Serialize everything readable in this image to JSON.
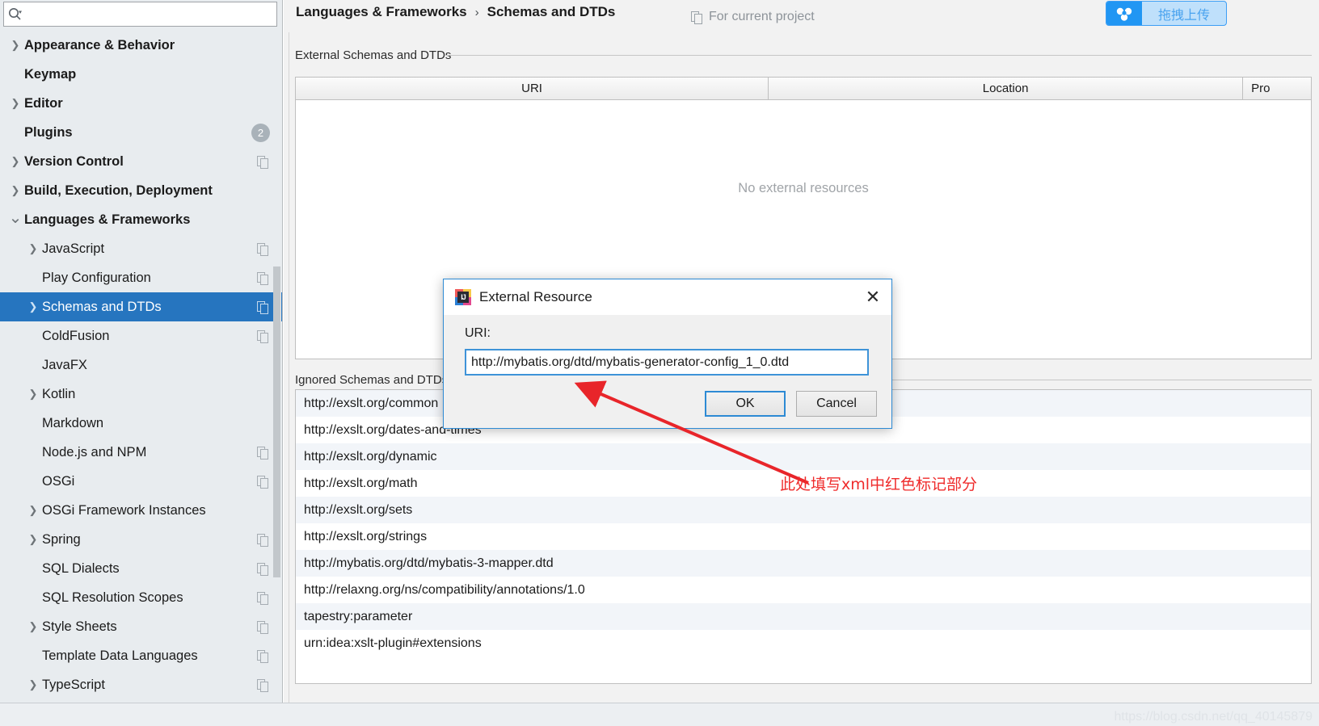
{
  "search": {
    "value": "",
    "placeholder": "",
    "icon": "search-icon"
  },
  "sidebar": {
    "items": [
      {
        "label": "Appearance & Behavior",
        "level": 0,
        "arrow": "right",
        "badge": null,
        "copy": false,
        "selected": false
      },
      {
        "label": "Keymap",
        "level": 0,
        "arrow": "none",
        "badge": null,
        "copy": false,
        "selected": false
      },
      {
        "label": "Editor",
        "level": 0,
        "arrow": "right",
        "badge": null,
        "copy": false,
        "selected": false
      },
      {
        "label": "Plugins",
        "level": 0,
        "arrow": "none",
        "badge": "2",
        "copy": false,
        "selected": false
      },
      {
        "label": "Version Control",
        "level": 0,
        "arrow": "right",
        "badge": null,
        "copy": true,
        "selected": false
      },
      {
        "label": "Build, Execution, Deployment",
        "level": 0,
        "arrow": "right",
        "badge": null,
        "copy": false,
        "selected": false
      },
      {
        "label": "Languages & Frameworks",
        "level": 0,
        "arrow": "down",
        "badge": null,
        "copy": false,
        "selected": false
      },
      {
        "label": "JavaScript",
        "level": 1,
        "arrow": "right",
        "badge": null,
        "copy": true,
        "selected": false
      },
      {
        "label": "Play Configuration",
        "level": 1,
        "arrow": "none",
        "badge": null,
        "copy": true,
        "selected": false
      },
      {
        "label": "Schemas and DTDs",
        "level": 1,
        "arrow": "right",
        "badge": null,
        "copy": true,
        "selected": true
      },
      {
        "label": "ColdFusion",
        "level": 1,
        "arrow": "none",
        "badge": null,
        "copy": true,
        "selected": false
      },
      {
        "label": "JavaFX",
        "level": 1,
        "arrow": "none",
        "badge": null,
        "copy": false,
        "selected": false
      },
      {
        "label": "Kotlin",
        "level": 1,
        "arrow": "right",
        "badge": null,
        "copy": false,
        "selected": false
      },
      {
        "label": "Markdown",
        "level": 1,
        "arrow": "none",
        "badge": null,
        "copy": false,
        "selected": false
      },
      {
        "label": "Node.js and NPM",
        "level": 1,
        "arrow": "none",
        "badge": null,
        "copy": true,
        "selected": false
      },
      {
        "label": "OSGi",
        "level": 1,
        "arrow": "none",
        "badge": null,
        "copy": true,
        "selected": false
      },
      {
        "label": "OSGi Framework Instances",
        "level": 1,
        "arrow": "right",
        "badge": null,
        "copy": false,
        "selected": false
      },
      {
        "label": "Spring",
        "level": 1,
        "arrow": "right",
        "badge": null,
        "copy": true,
        "selected": false
      },
      {
        "label": "SQL Dialects",
        "level": 1,
        "arrow": "none",
        "badge": null,
        "copy": true,
        "selected": false
      },
      {
        "label": "SQL Resolution Scopes",
        "level": 1,
        "arrow": "none",
        "badge": null,
        "copy": true,
        "selected": false
      },
      {
        "label": "Style Sheets",
        "level": 1,
        "arrow": "right",
        "badge": null,
        "copy": true,
        "selected": false
      },
      {
        "label": "Template Data Languages",
        "level": 1,
        "arrow": "none",
        "badge": null,
        "copy": true,
        "selected": false
      },
      {
        "label": "TypeScript",
        "level": 1,
        "arrow": "right",
        "badge": null,
        "copy": true,
        "selected": false
      }
    ]
  },
  "breadcrumb": {
    "parent": "Languages & Frameworks",
    "separator": "›",
    "current": "Schemas and DTDs"
  },
  "scope_label": "For current project",
  "external_section": {
    "title": "External Schemas and DTDs",
    "columns": [
      "URI",
      "Location",
      "Pro"
    ],
    "empty_message": "No external resources",
    "rows": []
  },
  "ignored_section": {
    "title": "Ignored Schemas and DTDs",
    "rows": [
      "http://exslt.org/common",
      "http://exslt.org/dates-and-times",
      "http://exslt.org/dynamic",
      "http://exslt.org/math",
      "http://exslt.org/sets",
      "http://exslt.org/strings",
      "http://mybatis.org/dtd/mybatis-3-mapper.dtd",
      "http://relaxng.org/ns/compatibility/annotations/1.0",
      "tapestry:parameter",
      "urn:idea:xslt-plugin#extensions"
    ]
  },
  "dialog": {
    "title": "External Resource",
    "app_icon_text": "IJ",
    "close_glyph": "✕",
    "uri_label": "URI:",
    "uri_value": "http://mybatis.org/dtd/mybatis-generator-config_1_0.dtd",
    "ok_label": "OK",
    "cancel_label": "Cancel"
  },
  "annotation": {
    "text": "此处填写xml中红色标记部分",
    "color": "#ef2b2b"
  },
  "upload_pill": {
    "label": "拖拽上传",
    "icon": "cloud-upload-icon",
    "accent": "#2196f3"
  },
  "watermark": "https://blog.csdn.net/qq_40145879",
  "colors": {
    "selection": "#2675bf",
    "dialog_border": "#2d8ad4",
    "sidebar_bg": "#e8ecef"
  }
}
